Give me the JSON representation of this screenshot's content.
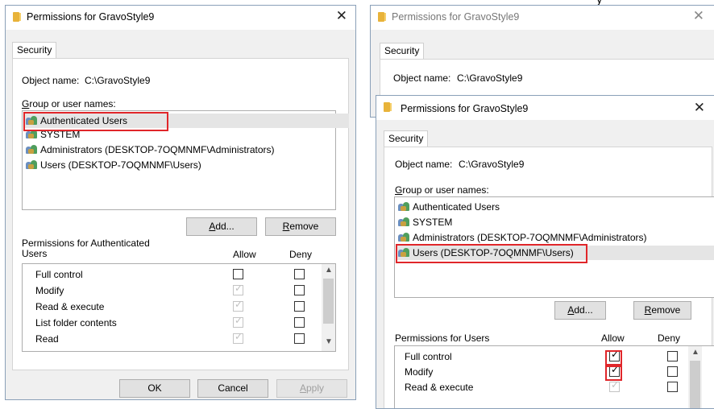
{
  "top_clipped_text": "y",
  "window_title": "Permissions for GravoStyle9",
  "tab_security": "Security",
  "object_name_label": "Object name:",
  "object_path": "C:\\GravoStyle9",
  "group_label": "Group or user names:",
  "users": [
    "Authenticated Users",
    "SYSTEM",
    "Administrators (DESKTOP-7OQMNMF\\Administrators)",
    "Users (DESKTOP-7OQMNMF\\Users)"
  ],
  "add_button": "Add...",
  "remove_button": "Remove",
  "allow_header": "Allow",
  "deny_header": "Deny",
  "left": {
    "perm_label_line1": "Permissions for Authenticated",
    "perm_label_line2": "Users",
    "selected_user_index": 0,
    "permissions": [
      {
        "name": "Full control",
        "allow": false,
        "allow_enabled": true,
        "deny": false
      },
      {
        "name": "Modify",
        "allow": true,
        "allow_enabled": false,
        "deny": false
      },
      {
        "name": "Read & execute",
        "allow": true,
        "allow_enabled": false,
        "deny": false
      },
      {
        "name": "List folder contents",
        "allow": true,
        "allow_enabled": false,
        "deny": false
      },
      {
        "name": "Read",
        "allow": true,
        "allow_enabled": false,
        "deny": false
      }
    ],
    "ok_button": "OK",
    "cancel_button": "Cancel",
    "apply_button": "Apply"
  },
  "right": {
    "perm_label": "Permissions for Users",
    "selected_user_index": 3,
    "permissions": [
      {
        "name": "Full control",
        "allow": true,
        "allow_enabled": true,
        "deny": false
      },
      {
        "name": "Modify",
        "allow": true,
        "allow_enabled": true,
        "deny": false
      },
      {
        "name": "Read & execute",
        "allow": true,
        "allow_enabled": false,
        "deny": false
      }
    ]
  },
  "colors": {
    "highlight_box": "#e0262a",
    "folder_icon": "#e8b33a"
  }
}
